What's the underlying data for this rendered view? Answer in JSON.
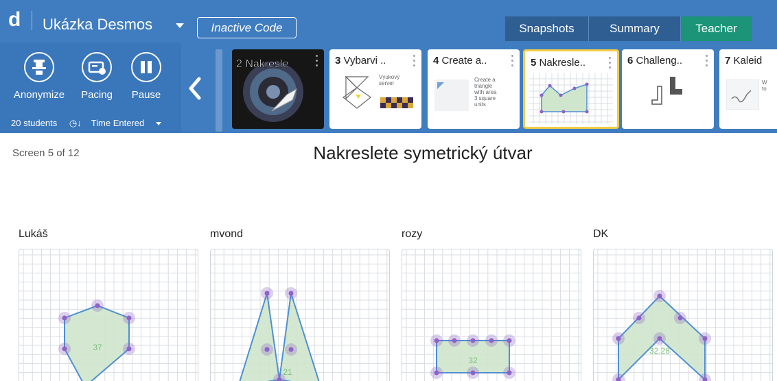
{
  "header": {
    "logo": "d",
    "activity_title": "Ukázka Desmos",
    "code_label": "Inactive Code",
    "tabs": [
      {
        "label": "Snapshots",
        "active": false
      },
      {
        "label": "Summary",
        "active": false
      },
      {
        "label": "Teacher",
        "active": true
      }
    ]
  },
  "controls": {
    "anonymize": "Anonymize",
    "pacing": "Pacing",
    "pause": "Pause",
    "student_count": "20 students",
    "sort": "Time Entered"
  },
  "screens": [
    {
      "num": "2",
      "name": "Nakresle",
      "active": false
    },
    {
      "num": "3",
      "name": "Vybarvi ..",
      "active": false,
      "thumb_text": "Výukový server"
    },
    {
      "num": "4",
      "name": "Create a..",
      "active": false,
      "thumb_text": [
        "Create a",
        "triangle",
        "with area",
        "3 square",
        "units"
      ]
    },
    {
      "num": "5",
      "name": "Nakresle..",
      "active": true
    },
    {
      "num": "6",
      "name": "Challeng..",
      "active": false
    },
    {
      "num": "7",
      "name": "Kaleid",
      "active": false,
      "thumb_text": [
        "W",
        "to"
      ]
    }
  ],
  "main": {
    "screen_position": "Screen 5 of 12",
    "title": "Nakreslete symetrický útvar"
  },
  "students": [
    {
      "name": "Lukáš",
      "label": "37"
    },
    {
      "name": "mvond",
      "label": "21"
    },
    {
      "name": "rozy",
      "label": "32"
    },
    {
      "name": "DK",
      "label": "32.28"
    }
  ],
  "colors": {
    "topbar": "#3f7cc0",
    "active_tab": "#1b9478",
    "shape_fill": "#cfe5cc",
    "shape_stroke": "#4f8fd1",
    "point": "#8e63c7",
    "active_card_border": "#f3cc45"
  }
}
